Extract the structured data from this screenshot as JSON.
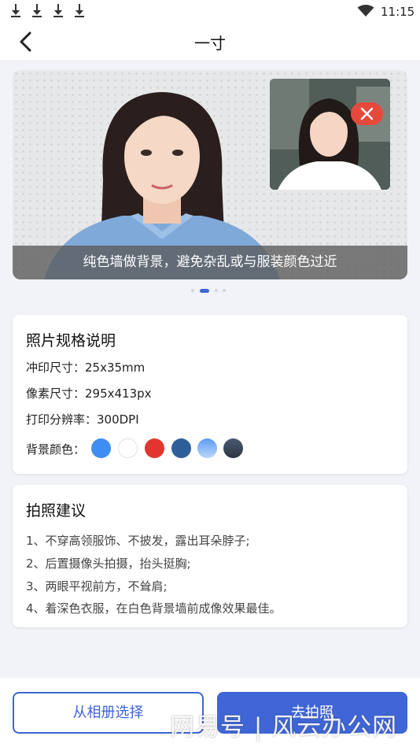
{
  "status_bar": {
    "time": "11:15",
    "download_icons": [
      "download-icon",
      "download-icon",
      "download-icon",
      "download-icon"
    ],
    "wifi_icon": "wifi-icon"
  },
  "header": {
    "title": "一寸",
    "back_icon": "chevron-left-icon"
  },
  "banner": {
    "caption": "纯色墙做背景，避免杂乱或与服装颜色过近",
    "badge_icon": "close-icon",
    "pages": 4,
    "active_page": 1
  },
  "spec": {
    "title": "照片规格说明",
    "print_size": "冲印尺寸：25x35mm",
    "pixel_size": "像素尺寸：295x413px",
    "resolution": "打印分辨率：300DPI",
    "bg_label": "背景颜色：",
    "bg_colors": [
      "#3d8df2",
      "#ffffff",
      "#e2352e",
      "#2f5f99",
      "#8dbcf9",
      "#384558"
    ]
  },
  "tips": {
    "title": "拍照建议",
    "items": [
      "1、不穿高领服饰、不披发，露出耳朵脖子;",
      "2、后置摄像头拍摄，抬头挺胸;",
      "3、两眼平视前方，不耸肩;",
      "4、着深色衣服，在白色背景墙前成像效果最佳。"
    ]
  },
  "buttons": {
    "album": "从相册选择",
    "camera": "去拍照"
  },
  "watermark": "网易号 | 风云办公网",
  "colors": {
    "accent": "#3f65d6",
    "error": "#e5493b"
  }
}
